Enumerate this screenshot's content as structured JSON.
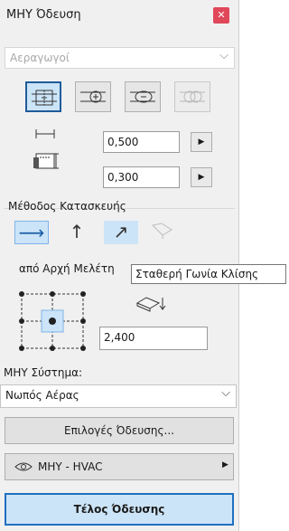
{
  "window": {
    "title": "ΜΗΥ Όδευση",
    "close_icon": "close-icon"
  },
  "type_dropdown": {
    "value": "Αεραγωγοί",
    "disabled": true
  },
  "alignment_tools": [
    {
      "name": "center-alignment",
      "active": true
    },
    {
      "name": "circle-alignment",
      "active": false
    },
    {
      "name": "oval-alignment",
      "active": false
    },
    {
      "name": "disabled-alignment",
      "active": false
    }
  ],
  "dimensions": {
    "width": "0,500",
    "height": "0,300"
  },
  "construction": {
    "label": "Μέθοδος Κατασκευής",
    "methods": [
      "horizontal",
      "vertical",
      "angled",
      "disabled"
    ],
    "active": "horizontal"
  },
  "reference": {
    "label": "από Αρχή Μελέτη"
  },
  "tooltip": {
    "text": "Σταθερή Γωνία Κλίσης"
  },
  "elevation": {
    "value": "2,400"
  },
  "system": {
    "label": "ΜΗΥ Σύστημα:",
    "value": "Νωπός Αέρας"
  },
  "routing_options_button": "Επιλογές Όδευσης...",
  "layer": {
    "value": "ΜΗΥ - HVAC"
  },
  "finish_button": "Τέλος Όδευσης",
  "colors": {
    "accent": "#1f5b9a",
    "selected_bg": "#cce4f7",
    "close": "#e0485a"
  }
}
